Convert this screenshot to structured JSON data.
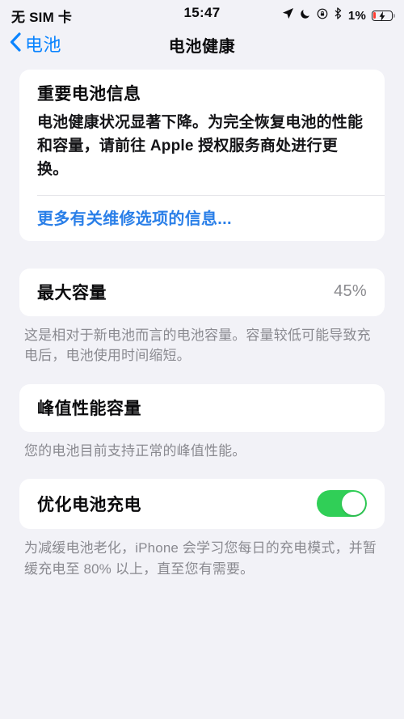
{
  "status_bar": {
    "carrier": "无 SIM 卡",
    "time": "15:47",
    "battery_percent": "1%",
    "icons": [
      "location-arrow-icon",
      "moon-icon",
      "rotation-lock-icon",
      "bluetooth-icon",
      "battery-charging-icon"
    ],
    "battery_fill_color": "#ff3b30"
  },
  "nav": {
    "back_label": "电池",
    "title": "电池健康",
    "tint_color": "#0a84ff"
  },
  "sections": {
    "important_info": {
      "title": "重要电池信息",
      "body": "电池健康状况显著下降。为完全恢复电池的性能和容量，请前往 Apple 授权服务商处进行更换。",
      "link": "更多有关维修选项的信息...",
      "link_color": "#2a7fe8"
    },
    "maximum_capacity": {
      "label": "最大容量",
      "value": "45%",
      "footer": "这是相对于新电池而言的电池容量。容量较低可能导致充电后，电池使用时间缩短。"
    },
    "peak_performance": {
      "label": "峰值性能容量",
      "footer": "您的电池目前支持正常的峰值性能。"
    },
    "optimized_charging": {
      "label": "优化电池充电",
      "toggle_state": "on",
      "toggle_color": "#30cf57",
      "footer": "为减缓电池老化，iPhone 会学习您每日的充电模式，并暂缓充电至 80% 以上，直至您有需要。"
    }
  }
}
